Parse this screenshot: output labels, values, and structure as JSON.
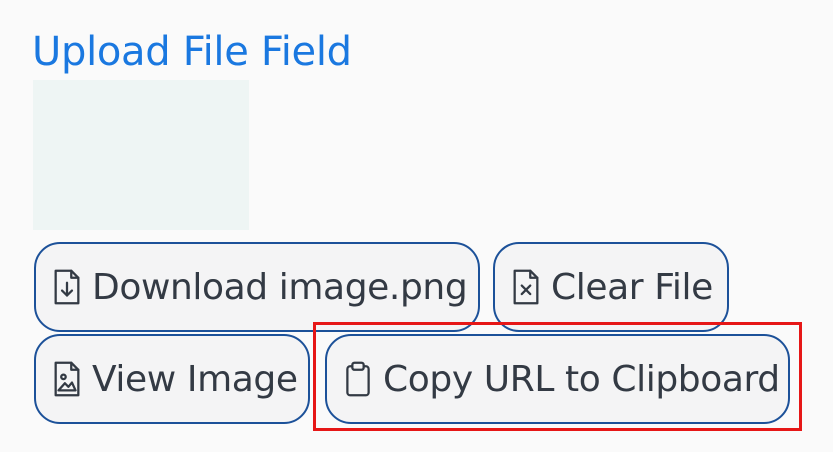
{
  "field": {
    "title": "Upload File Field"
  },
  "buttons": {
    "download_label": "Download image.png",
    "clear_label": "Clear File",
    "view_label": "View Image",
    "copy_label": "Copy URL to Clipboard"
  },
  "icons": {
    "download": "file-download-icon",
    "clear": "file-x-icon",
    "view": "file-image-icon",
    "copy": "clipboard-icon"
  },
  "colors": {
    "title": "#1a78e0",
    "button_border": "#1c5199",
    "highlight": "#e61717"
  }
}
